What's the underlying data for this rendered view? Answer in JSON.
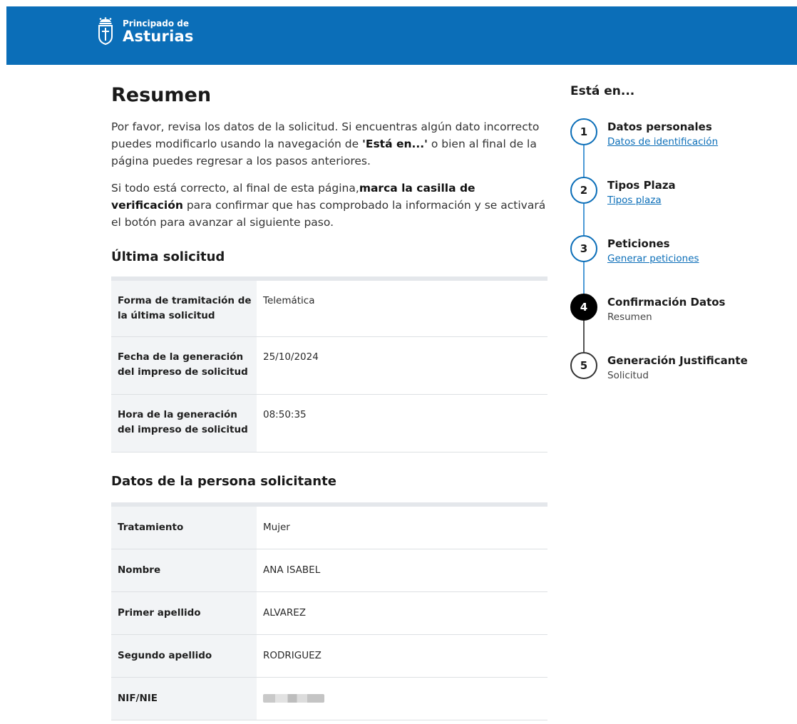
{
  "header": {
    "logo_line1": "Principado de",
    "logo_line2": "Asturias"
  },
  "main": {
    "title": "Resumen",
    "intro1_a": "Por favor, revisa los datos de la solicitud. Si encuentras algún dato incorrecto puedes modificarlo usando la navegación de ",
    "intro1_bold": "'Está en...'",
    "intro1_b": " o bien al final de la página puedes regresar a los pasos anteriores.",
    "intro2_a": "Si todo está correcto, al final de esta página,",
    "intro2_bold": "marca la casilla de verificación",
    "intro2_b": " para confirmar que has comprobado la información y se activará el botón para avanzar al siguiente paso.",
    "section1": {
      "title": "Última solicitud",
      "rows": [
        {
          "label": "Forma de tramitación de la última solicitud",
          "value": "Telemática"
        },
        {
          "label": "Fecha de la generación del impreso de solicitud",
          "value": "25/10/2024"
        },
        {
          "label": "Hora de la generación del impreso de solicitud",
          "value": "08:50:35"
        }
      ]
    },
    "section2": {
      "title": "Datos de la persona solicitante",
      "rows": [
        {
          "label": "Tratamiento",
          "value": "Mujer"
        },
        {
          "label": "Nombre",
          "value": "ANA ISABEL"
        },
        {
          "label": "Primer apellido",
          "value": "ALVAREZ"
        },
        {
          "label": "Segundo apellido",
          "value": "RODRIGUEZ"
        },
        {
          "label": "NIF/NIE",
          "value": ""
        }
      ]
    }
  },
  "aside": {
    "title": "Está en...",
    "steps": [
      {
        "number": "1",
        "title": "Datos personales",
        "sub": "Datos de identificación",
        "state": "done"
      },
      {
        "number": "2",
        "title": "Tipos Plaza",
        "sub": "Tipos plaza",
        "state": "done"
      },
      {
        "number": "3",
        "title": "Peticiones",
        "sub": "Generar peticiones",
        "state": "done"
      },
      {
        "number": "4",
        "title": "Confirmación Datos",
        "sub": "Resumen",
        "state": "current"
      },
      {
        "number": "5",
        "title": "Generación Justificante",
        "sub": "Solicitud",
        "state": "pending"
      }
    ]
  },
  "colors": {
    "brand_blue": "#0b6eb8",
    "active_step": "#000000",
    "label_background": "#f2f4f6"
  }
}
